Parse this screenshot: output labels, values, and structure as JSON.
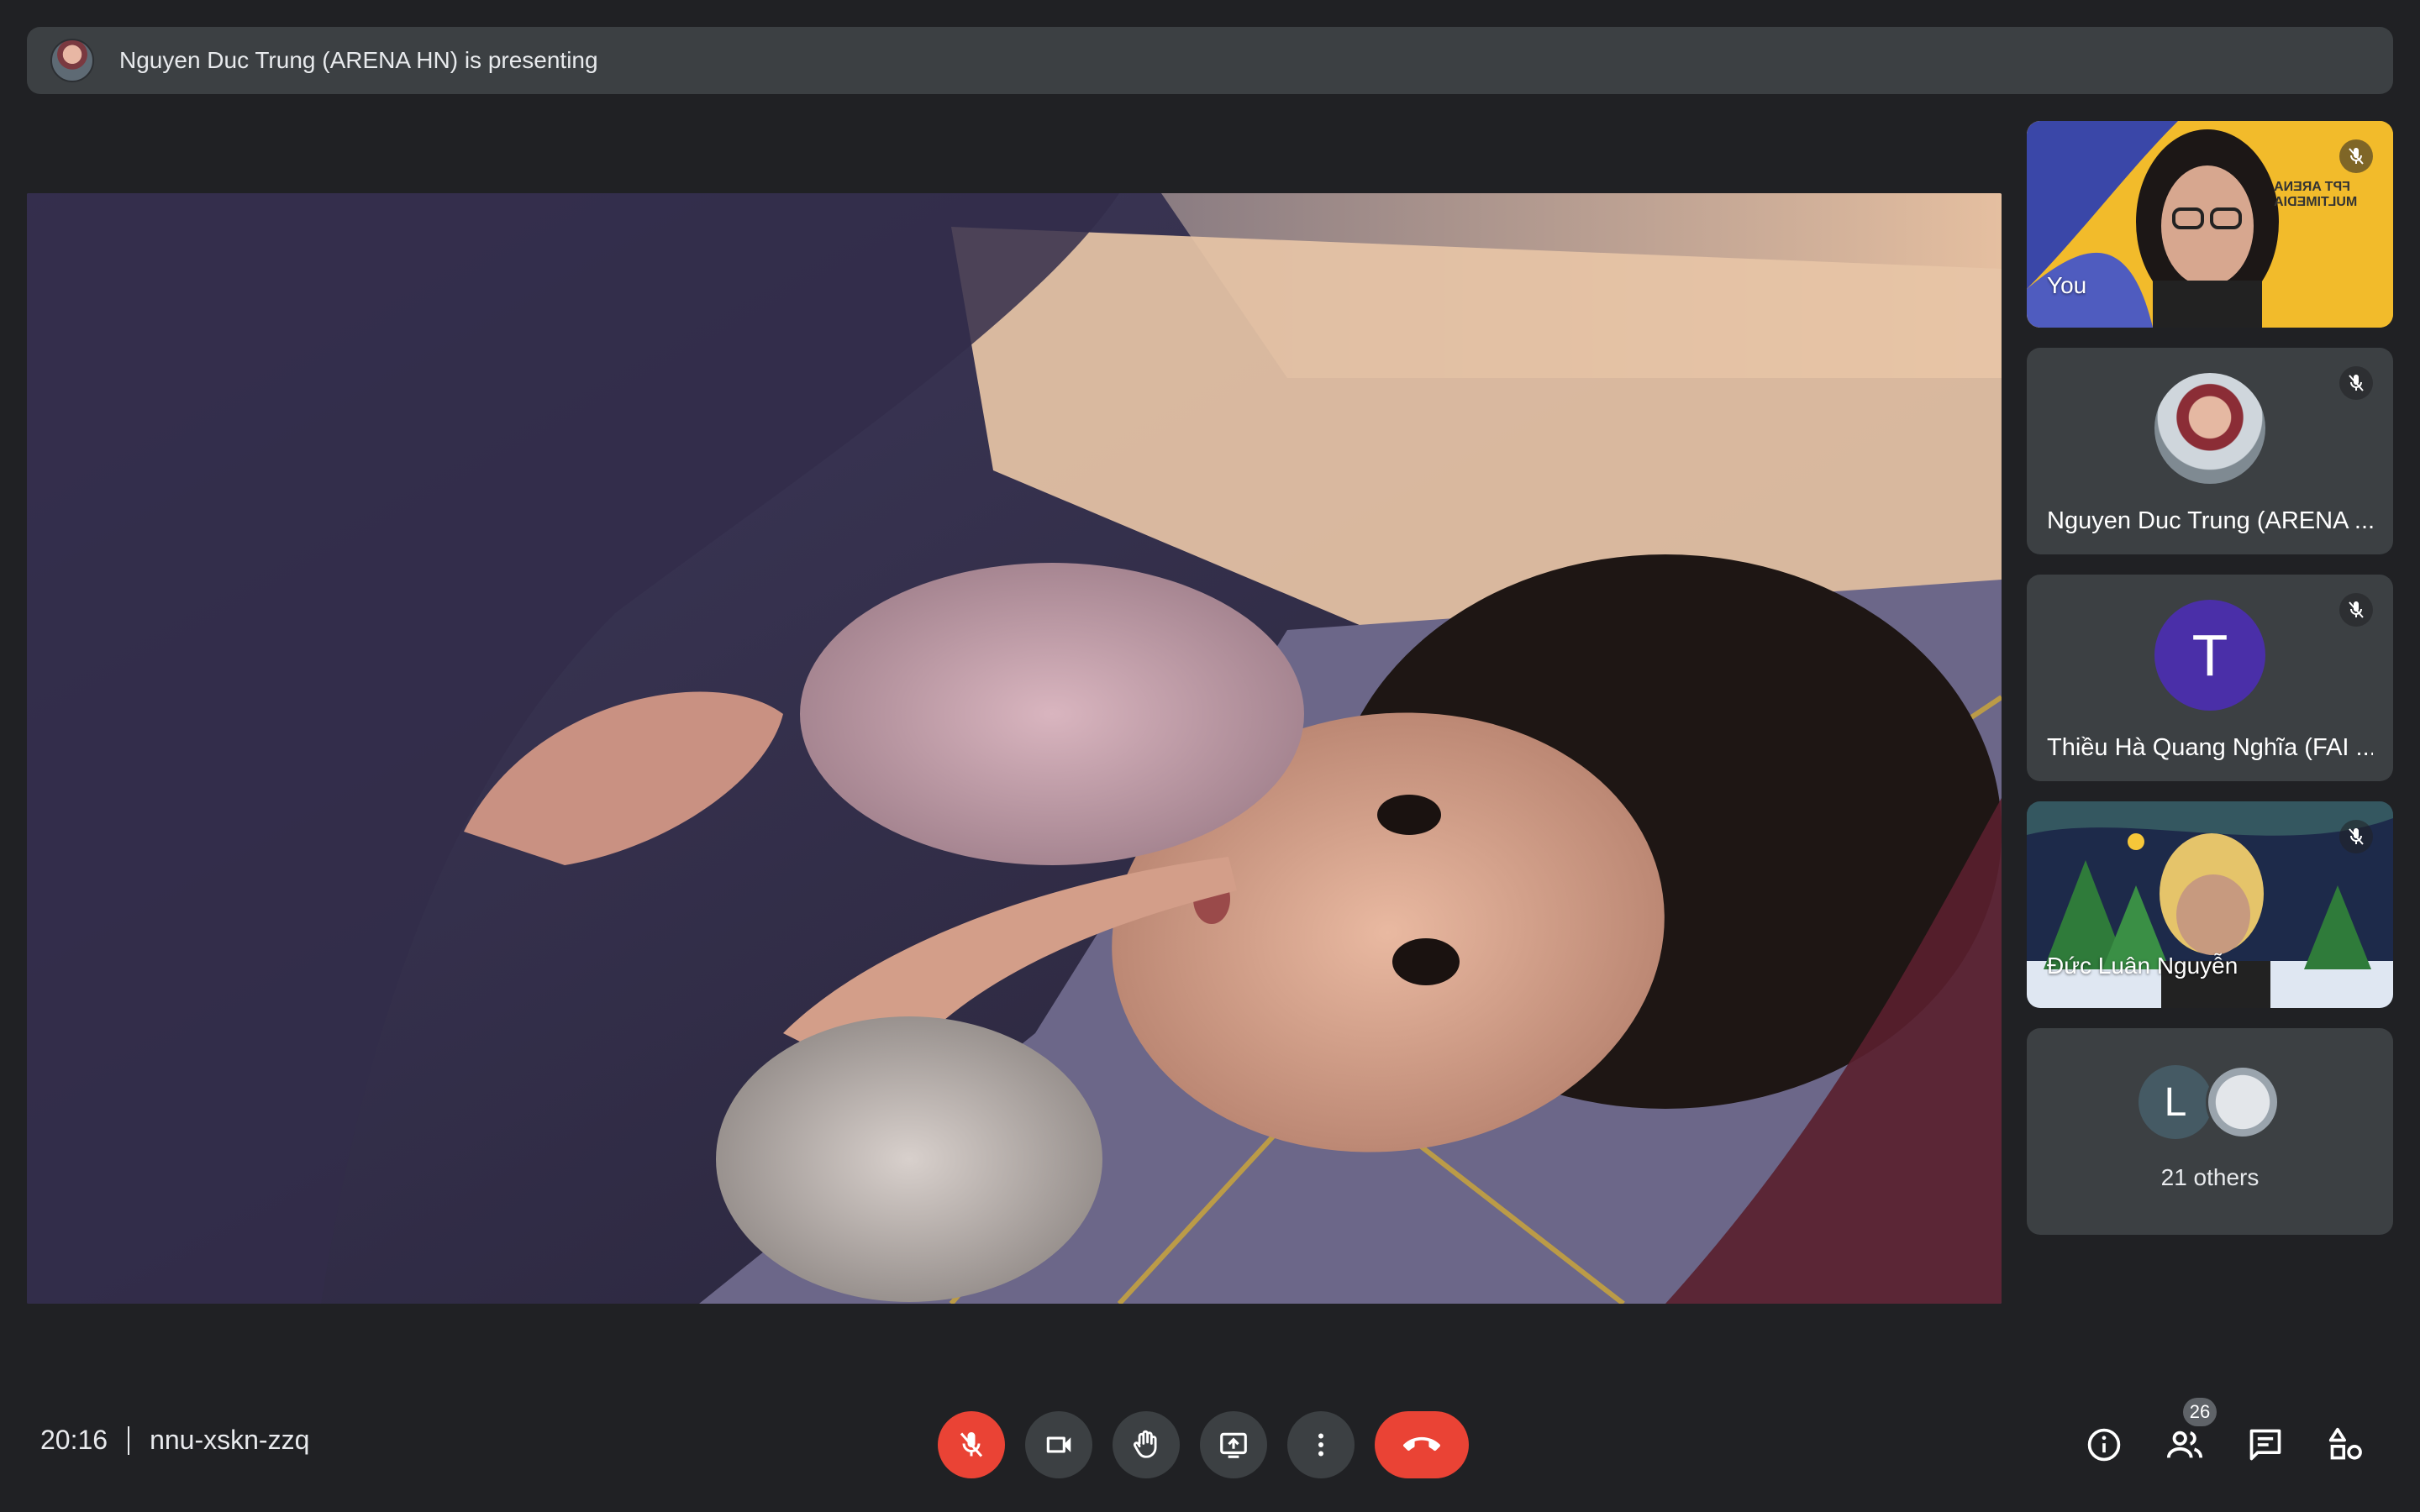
{
  "banner": {
    "presenting_text": "Nguyen Duc Trung (ARENA HN) is presenting"
  },
  "participants": [
    {
      "name": "You",
      "muted": true,
      "type": "video"
    },
    {
      "name": "Nguyen Duc Trung (ARENA ...",
      "muted": true,
      "type": "photo-avatar"
    },
    {
      "name": "Thiều Hà Quang Nghĩa (FAI ...",
      "muted": true,
      "type": "letter-avatar",
      "initial": "T",
      "color": "#4a2fa8"
    },
    {
      "name": "Đức Luân Nguyễn",
      "muted": true,
      "type": "video"
    }
  ],
  "others": {
    "initial": "L",
    "label": "21 others"
  },
  "tile_you_sign": "FPT ARENA MULTIMEDIA",
  "meeting": {
    "time": "20:16",
    "code": "nnu-xskn-zzq"
  },
  "people_count": "26",
  "colors": {
    "background": "#202124",
    "tile": "#3c4043",
    "danger": "#ea4335"
  },
  "icons": {
    "mic": "mic-off-icon",
    "camera": "videocam-icon",
    "hand": "raise-hand-icon",
    "present": "present-screen-icon",
    "more": "more-vert-icon",
    "leave": "call-end-icon",
    "info": "info-icon",
    "people": "people-icon",
    "chat": "chat-icon",
    "activities": "activities-icon"
  }
}
